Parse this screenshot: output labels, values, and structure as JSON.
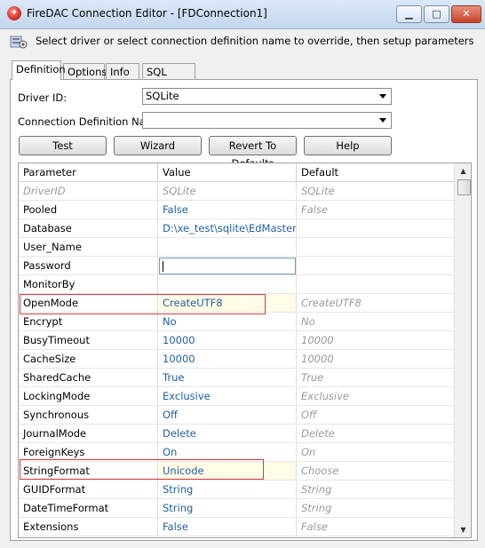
{
  "window": {
    "title": "FireDAC Connection Editor - [FDConnection1]",
    "minimize": "▁",
    "maximize": "□",
    "close": "✕"
  },
  "hint": "Select driver or select connection definition name to override, then setup parameters",
  "tabs": [
    {
      "label": "Definition",
      "active": true
    },
    {
      "label": "Options"
    },
    {
      "label": "Info"
    },
    {
      "label": "SQL Script"
    }
  ],
  "form": {
    "driver_label": "Driver ID:",
    "driver_value": "SQLite",
    "conn_label": "Connection Definition Name:",
    "conn_value": ""
  },
  "buttons": {
    "test": "Test",
    "wizard": "Wizard",
    "revert": "Revert To Defaults",
    "help": "Help"
  },
  "grid": {
    "columns": [
      "Parameter",
      "Value",
      "Default"
    ],
    "rows": [
      {
        "param": "DriverID",
        "value": "SQLite",
        "default": "SQLite"
      },
      {
        "param": "Pooled",
        "value": "False",
        "default": "False"
      },
      {
        "param": "Database",
        "value": "D:\\xe_test\\sqlite\\EdMaster.db",
        "default": ""
      },
      {
        "param": "User_Name",
        "value": "",
        "default": ""
      },
      {
        "param": "Password",
        "value": "",
        "default": ""
      },
      {
        "param": "MonitorBy",
        "value": "",
        "default": ""
      },
      {
        "param": "OpenMode",
        "value": "CreateUTF8",
        "default": "CreateUTF8"
      },
      {
        "param": "Encrypt",
        "value": "No",
        "default": "No"
      },
      {
        "param": "BusyTimeout",
        "value": "10000",
        "default": "10000"
      },
      {
        "param": "CacheSize",
        "value": "10000",
        "default": "10000"
      },
      {
        "param": "SharedCache",
        "value": "True",
        "default": "True"
      },
      {
        "param": "LockingMode",
        "value": "Exclusive",
        "default": "Exclusive"
      },
      {
        "param": "Synchronous",
        "value": "Off",
        "default": "Off"
      },
      {
        "param": "JournalMode",
        "value": "Delete",
        "default": "Delete"
      },
      {
        "param": "ForeignKeys",
        "value": "On",
        "default": "On"
      },
      {
        "param": "StringFormat",
        "value": "Unicode",
        "default": "Choose"
      },
      {
        "param": "GUIDFormat",
        "value": "String",
        "default": "String"
      },
      {
        "param": "DateTimeFormat",
        "value": "String",
        "default": "String"
      },
      {
        "param": "Extensions",
        "value": "False",
        "default": "False"
      }
    ]
  },
  "highlight_color": "#e0383a"
}
